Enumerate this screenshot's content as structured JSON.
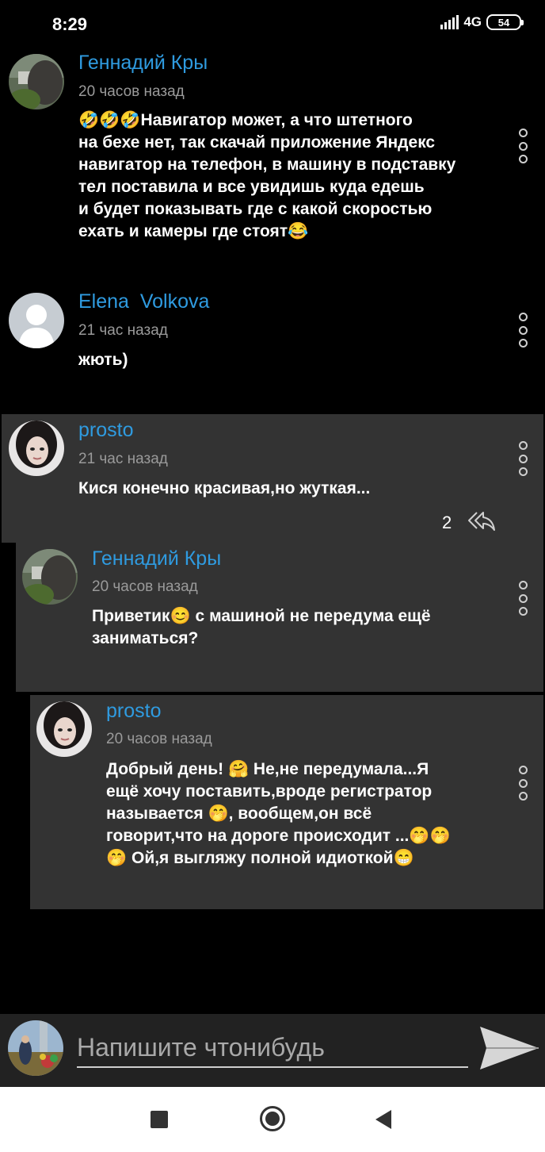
{
  "status_bar": {
    "time": "8:29",
    "network": "4G",
    "battery": "54"
  },
  "comments": [
    {
      "author": "Геннадий Кры",
      "time": "20 часов назад",
      "lines": [
        "🤣🤣🤣Навигатор может, а что штетного",
        "на бехе нет, так скачай приложение Яндекс",
        "навигатор на телефон, в машину в подставку",
        "тел поставила и все увидишь куда едешь",
        "и будет показывать где с какой скоростью",
        "ехать и камеры где стоят😂"
      ],
      "avatar_icon": "cat-photo-avatar"
    },
    {
      "author": "Elena  Volkova",
      "time": "21 час назад",
      "lines": [
        "жють)"
      ],
      "avatar_icon": "default-person-avatar"
    },
    {
      "author": "prosto",
      "time": "21 час назад",
      "lines": [
        "Кися конечно красивая,но жуткая..."
      ],
      "reply_count": "2",
      "avatar_icon": "woman-photo-avatar"
    },
    {
      "author": "Геннадий Кры",
      "time": "20 часов назад",
      "lines": [
        "Приветик😊 с машиной не передума ещё",
        "заниматься?"
      ],
      "avatar_icon": "cat-photo-avatar"
    },
    {
      "author": "prosto",
      "time": "20 часов назад",
      "lines": [
        "Добрый день! 🤗 Не,не передумала...Я",
        "ещё хочу поставить,вроде регистратор",
        "называется 🤭, вообщем,он всё",
        "говорит,что на дороге происходит ...🤭🤭",
        "🤭 Ой,я выгляжу полной идиоткой😁"
      ],
      "avatar_icon": "woman-photo-avatar"
    }
  ],
  "composer": {
    "placeholder": "Напишите чтонибудь",
    "avatar_icon": "user-photo-avatar",
    "send_icon": "send-arrow-icon"
  },
  "colors": {
    "author": "#2f9be0",
    "reply_bg": "#333333",
    "background": "#000000"
  }
}
